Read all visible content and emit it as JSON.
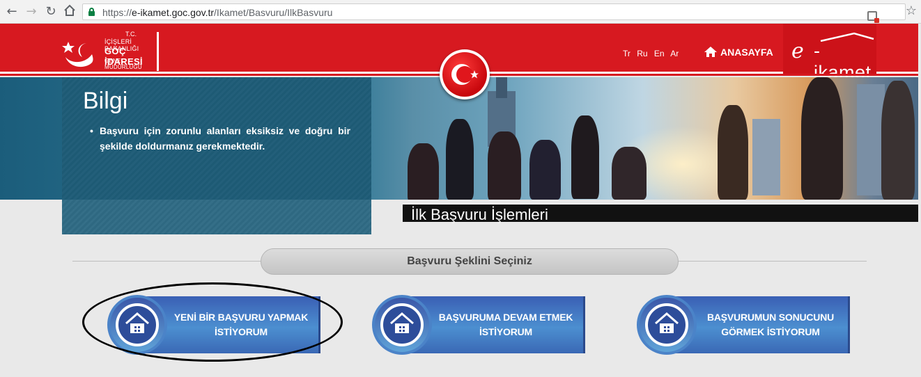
{
  "browser": {
    "url_scheme": "https://",
    "url_domain": "e-ikamet.goc.gov.tr",
    "url_path": "/Ikamet/Basvuru/IlkBasvuru"
  },
  "header": {
    "logo_line1": "T.C.",
    "logo_line2": "İÇİŞLERİ BAKANLIĞI",
    "logo_line3": "GÖÇ İDARESİ",
    "logo_line4": "GENEL MÜDÜRLÜĞÜ",
    "languages": [
      "Tr",
      "Ru",
      "En",
      "Ar"
    ],
    "home_label": "ANASAYFA",
    "brand_e": "e",
    "brand_rest": "-ikamet"
  },
  "info": {
    "title": "Bilgi",
    "text": "Başvuru için zorunlu alanları eksiksiz ve doğru bir şekilde doldurmanız gerekmektedir."
  },
  "section": {
    "title": "İlk Başvuru İşlemleri"
  },
  "selection": {
    "heading": "Başvuru Şeklini Seçiniz",
    "buttons": [
      {
        "label": "YENİ BİR BAŞVURU YAPMAK İSTİYORUM"
      },
      {
        "label": "BAŞVURUMA DEVAM ETMEK İSTİYORUM"
      },
      {
        "label": "BAŞVURUMUN SONUCUNU GÖRMEK İSTİYORUM"
      }
    ]
  },
  "colors": {
    "header_red": "#d71920",
    "button_blue": "#4c8fd0",
    "info_teal": "#1d5a74"
  }
}
